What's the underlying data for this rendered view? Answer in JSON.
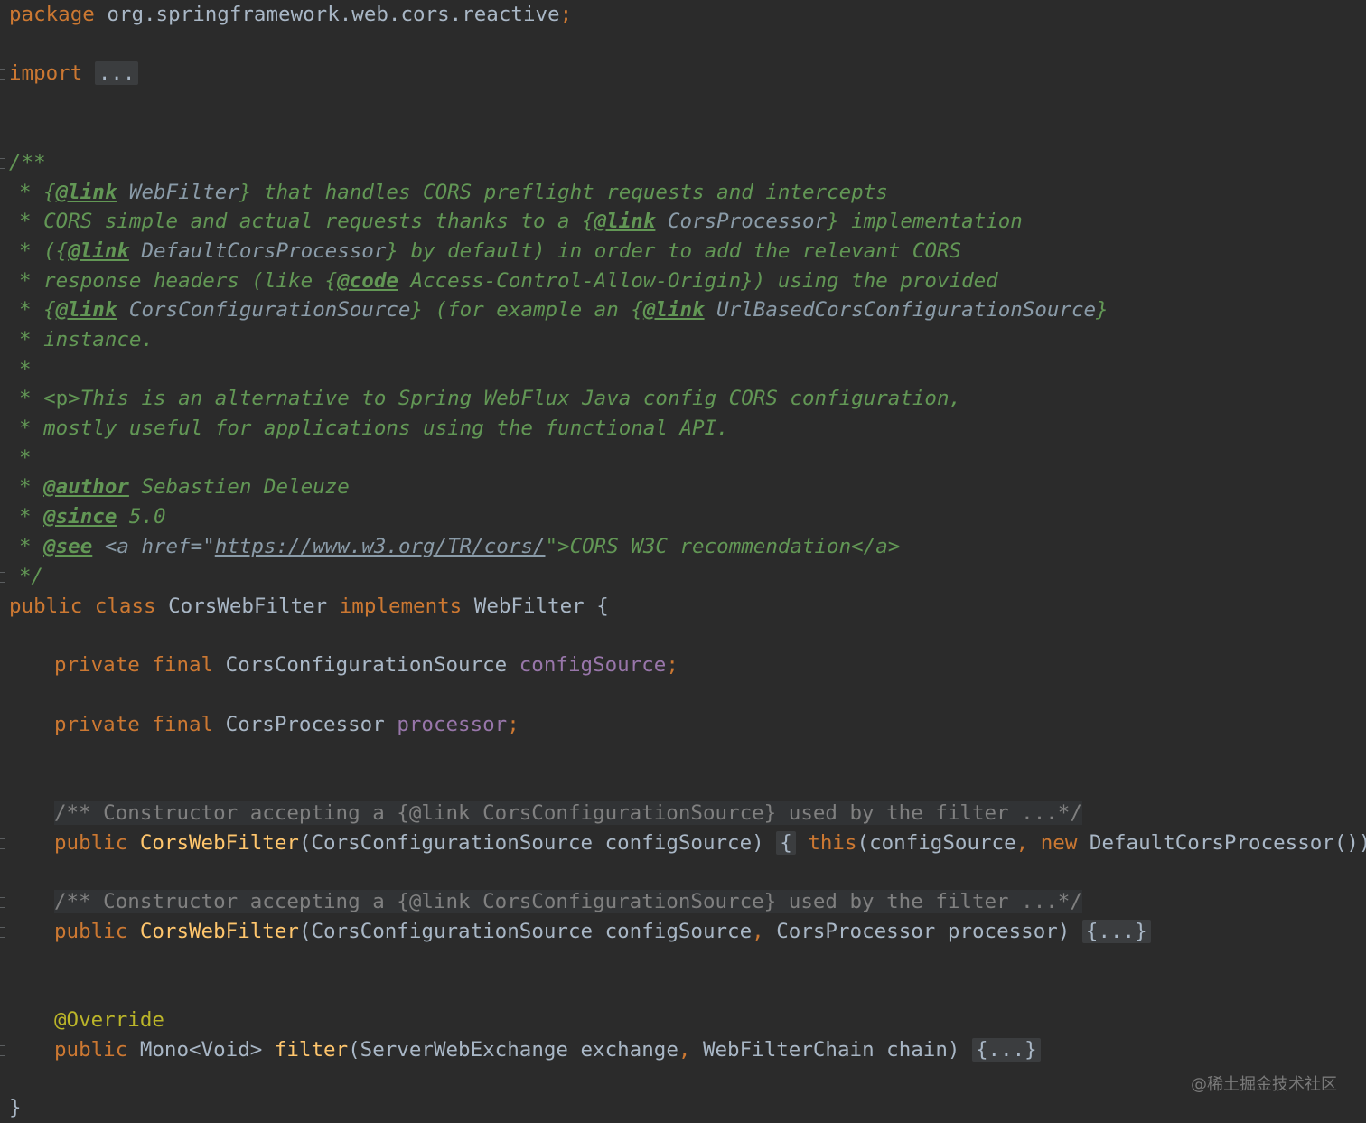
{
  "code": {
    "package_kw": "package",
    "package_name": "org.springframework.web.cors.reactive",
    "semicolon": ";",
    "import_kw": "import",
    "import_fold": "...",
    "javadoc": {
      "open": "/**",
      "star": "*",
      "close": "*/",
      "l1": {
        "tag": "@link",
        "ref": "WebFilter",
        "text": "that handles CORS preflight requests and intercepts"
      },
      "l2": {
        "text_a": "CORS simple and actual requests thanks to a",
        "tag": "@link",
        "ref": "CorsProcessor",
        "text_b": "implementation"
      },
      "l3": {
        "tag": "@link",
        "ref": "DefaultCorsProcessor",
        "text": "by default) in order to add the relevant CORS"
      },
      "l4": {
        "text_a": "response headers (like",
        "tag": "@code",
        "ref": "Access-Control-Allow-Origin",
        "text_b": ") using the provided"
      },
      "l5": {
        "tag1": "@link",
        "ref1": "CorsConfigurationSource",
        "text": "(for example an",
        "tag2": "@link",
        "ref2": "UrlBasedCorsConfigurationSource"
      },
      "l6": "instance.",
      "l8": {
        "p_tag": "<p>",
        "text": "This is an alternative to Spring WebFlux Java config CORS configuration,"
      },
      "l9": "mostly useful for applications using the functional API.",
      "author_tag": "@author",
      "author": "Sebastien Deleuze",
      "since_tag": "@since",
      "since": "5.0",
      "see_tag": "@see",
      "see_pre": "<a href=\"",
      "see_url": "https://www.w3.org/TR/cors/",
      "see_post": "\">CORS W3C recommendation</a>"
    },
    "class_line": {
      "public": "public",
      "class": "class",
      "name": "CorsWebFilter",
      "implements": "implements",
      "iface": "WebFilter",
      "brace": "{"
    },
    "field1": {
      "private": "private",
      "final": "final",
      "type": "CorsConfigurationSource",
      "name": "configSource"
    },
    "field2": {
      "private": "private",
      "final": "final",
      "type": "CorsProcessor",
      "name": "processor"
    },
    "ctor_doc_text": "/** Constructor accepting a {@link CorsConfigurationSource} used by the filter ...*/",
    "ctor1": {
      "public": "public",
      "name": "CorsWebFilter",
      "params": "(CorsConfigurationSource configSource)",
      "open": "{",
      "this_kw": "this",
      "args_a": "(configSource",
      "comma": ",",
      "new_kw": "new",
      "args_b": "DefaultCorsProcessor())",
      "semi": ";",
      "close": "}"
    },
    "ctor2": {
      "public": "public",
      "name": "CorsWebFilter",
      "params_a": "(CorsConfigurationSource configSource",
      "comma": ",",
      "params_b": "CorsProcessor processor)",
      "fold": "{...}"
    },
    "override": "@Override",
    "filter": {
      "public": "public",
      "ret": "Mono<Void>",
      "name": "filter",
      "params_a": "(ServerWebExchange exchange",
      "comma": ",",
      "params_b": "WebFilterChain chain)",
      "fold": "{...}"
    },
    "close_brace": "}"
  },
  "watermark": "@稀土掘金技术社区"
}
